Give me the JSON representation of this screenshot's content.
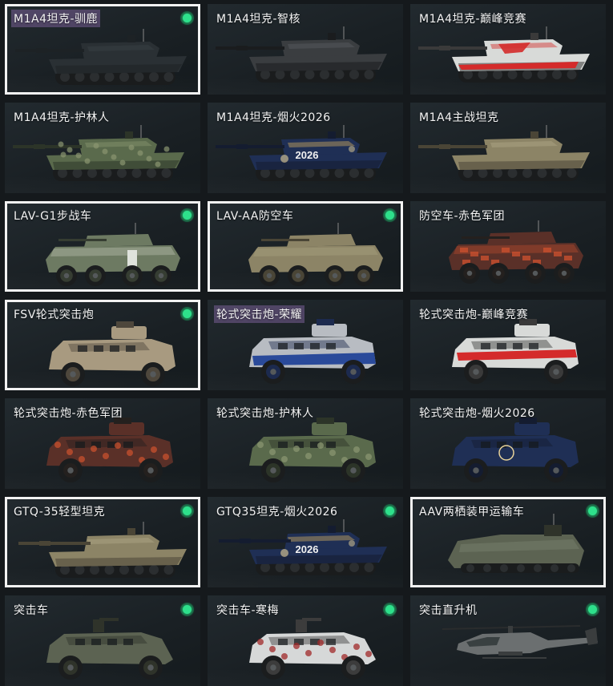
{
  "vehicles": [
    {
      "label": "M1A4坦克-驯鹿",
      "kind": "tank",
      "skin": "plain",
      "selected": true,
      "owned": true,
      "highlight": true
    },
    {
      "label": "M1A4坦克-智核",
      "kind": "tank",
      "skin": "dark",
      "selected": false,
      "owned": false,
      "highlight": false
    },
    {
      "label": "M1A4坦克-巅峰竞赛",
      "kind": "tank",
      "skin": "race",
      "selected": false,
      "owned": false,
      "highlight": false
    },
    {
      "label": "M1A4坦克-护林人",
      "kind": "tank",
      "skin": "forest",
      "selected": false,
      "owned": false,
      "highlight": false
    },
    {
      "label": "M1A4坦克-烟火2026",
      "kind": "tank",
      "skin": "fireworks",
      "selected": false,
      "owned": false,
      "highlight": false,
      "decal": "2026"
    },
    {
      "label": "M1A4主战坦克",
      "kind": "tank",
      "skin": "tan",
      "selected": false,
      "owned": false,
      "highlight": false
    },
    {
      "label": "LAV-G1步战车",
      "kind": "apc",
      "skin": "green",
      "selected": true,
      "owned": true,
      "highlight": false
    },
    {
      "label": "LAV-AA防空车",
      "kind": "apc",
      "skin": "tan",
      "selected": true,
      "owned": true,
      "highlight": false
    },
    {
      "label": "防空车-赤色军团",
      "kind": "apc",
      "skin": "red",
      "selected": false,
      "owned": false,
      "highlight": false
    },
    {
      "label": "FSV轮式突击炮",
      "kind": "fsv",
      "skin": "desert",
      "selected": true,
      "owned": true,
      "highlight": false
    },
    {
      "label": "轮式突击炮-荣耀",
      "kind": "fsv",
      "skin": "glory",
      "selected": false,
      "owned": false,
      "highlight": true
    },
    {
      "label": "轮式突击炮-巅峰竞赛",
      "kind": "fsv",
      "skin": "race",
      "selected": false,
      "owned": false,
      "highlight": false
    },
    {
      "label": "轮式突击炮-赤色军团",
      "kind": "fsv",
      "skin": "red",
      "selected": false,
      "owned": false,
      "highlight": false
    },
    {
      "label": "轮式突击炮-护林人",
      "kind": "fsv",
      "skin": "forest",
      "selected": false,
      "owned": false,
      "highlight": false
    },
    {
      "label": "轮式突击炮-烟火2026",
      "kind": "fsv",
      "skin": "fireworks",
      "selected": false,
      "owned": false,
      "highlight": false
    },
    {
      "label": "GTQ-35轻型坦克",
      "kind": "light",
      "skin": "tan",
      "selected": true,
      "owned": true,
      "highlight": false
    },
    {
      "label": "GTQ35坦克-烟火2026",
      "kind": "light",
      "skin": "fireworks",
      "selected": false,
      "owned": true,
      "highlight": false,
      "decal": "2026"
    },
    {
      "label": "AAV两栖装甲运输车",
      "kind": "aav",
      "skin": "olive",
      "selected": true,
      "owned": true,
      "highlight": false
    },
    {
      "label": "突击车",
      "kind": "truck",
      "skin": "olive",
      "selected": false,
      "owned": true,
      "highlight": false
    },
    {
      "label": "突击车-寒梅",
      "kind": "truck",
      "skin": "white",
      "selected": false,
      "owned": true,
      "highlight": false
    },
    {
      "label": "突击直升机",
      "kind": "heli",
      "skin": "grey",
      "selected": false,
      "owned": true,
      "highlight": false
    }
  ],
  "skins": {
    "plain": {
      "hull": "#2a3034",
      "dark": "#1d2225",
      "accent": "#3a4246"
    },
    "dark": {
      "hull": "#3a3d40",
      "dark": "#1a1c1e",
      "accent": "#5a5e62"
    },
    "race": {
      "hull": "#d8dad8",
      "dark": "#3a3a3a",
      "accent": "#d42b2b"
    },
    "forest": {
      "hull": "#5a6a4c",
      "dark": "#2c3428",
      "accent": "#8a9670"
    },
    "fireworks": {
      "hull": "#1f2f55",
      "dark": "#141c30",
      "accent": "#c9a860"
    },
    "tan": {
      "hull": "#8c8466",
      "dark": "#4a4536",
      "accent": "#b0a888"
    },
    "green": {
      "hull": "#6d7a62",
      "dark": "#363d32",
      "accent": "#c8cdc0"
    },
    "red": {
      "hull": "#5a3028",
      "dark": "#24201e",
      "accent": "#c8502e"
    },
    "desert": {
      "hull": "#a89a80",
      "dark": "#4e473c",
      "accent": "#cfc3ab"
    },
    "glory": {
      "hull": "#b8bcc2",
      "dark": "#1c2a4e",
      "accent": "#2a4a9a"
    },
    "olive": {
      "hull": "#5c6352",
      "dark": "#2f332a",
      "accent": "#7e8672"
    },
    "white": {
      "hull": "#d6d8d8",
      "dark": "#3c3c3c",
      "accent": "#a02a2a"
    },
    "grey": {
      "hull": "#6b6f70",
      "dark": "#3a3d3e",
      "accent": "#8a8e8f"
    }
  }
}
